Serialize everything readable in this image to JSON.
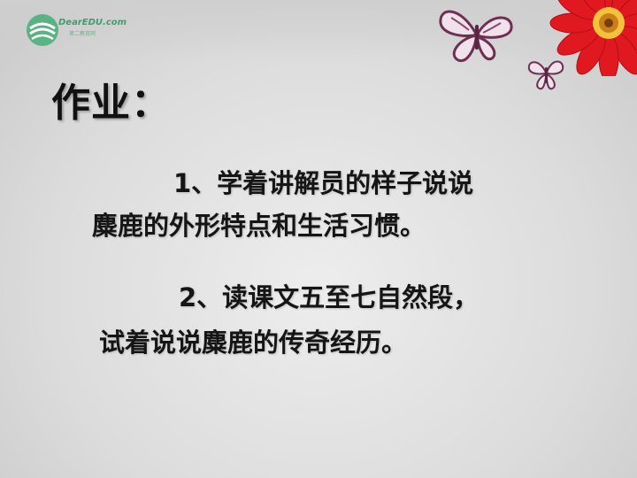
{
  "logo": {
    "text": "DearEDU.com",
    "subtext": "第二教育网"
  },
  "heading": "作业：",
  "assignments": [
    {
      "line1": "1、学着讲解员的样子说说",
      "line2": "麋鹿的外形特点和生活习惯。"
    },
    {
      "line1": "2、读课文五至七自然段，",
      "line2": "试着说说麋鹿的传奇经历。"
    }
  ],
  "colors": {
    "background": "#dcdcdc",
    "text": "#151515",
    "logo_green": "#3f9f6e",
    "butterfly": "#7a3a5c",
    "flower_red": "#e01820",
    "flower_center": "#f2c23a"
  },
  "icons": [
    "logo-icon",
    "butterfly-icon",
    "flower-icon"
  ]
}
